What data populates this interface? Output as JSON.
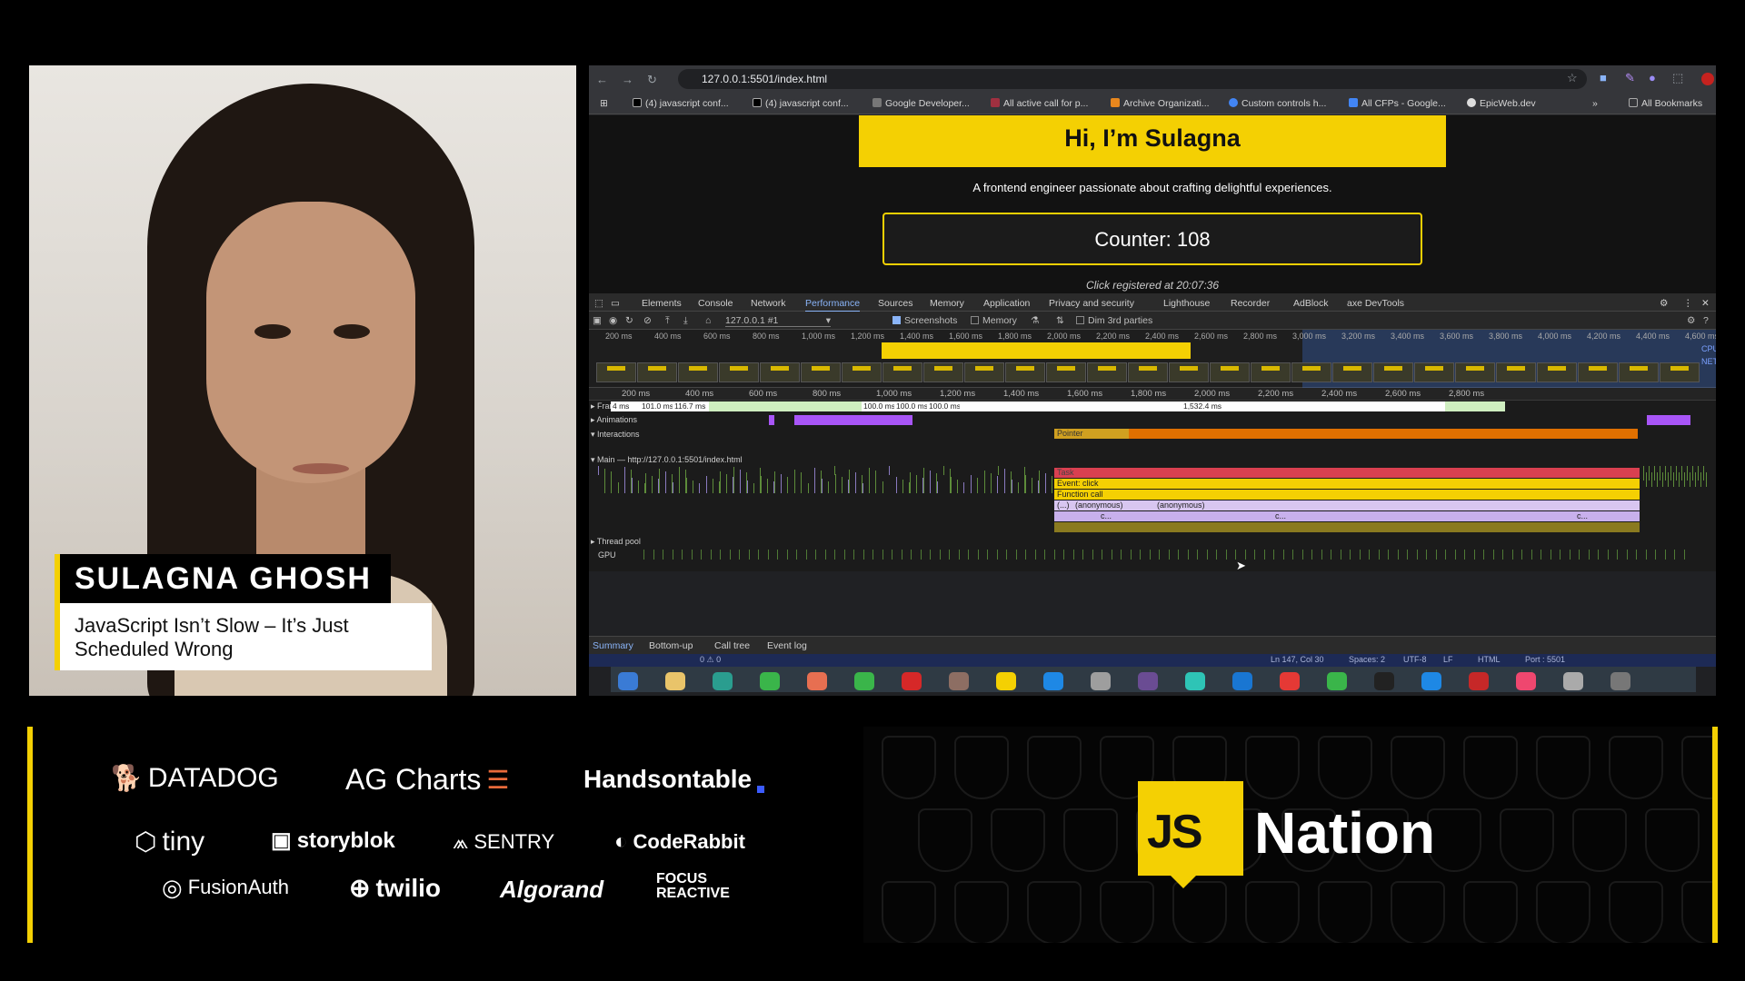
{
  "speaker": {
    "name": "SULAGNA GHOSH",
    "talk_title": "JavaScript Isn’t Slow – It’s Just Scheduled Wrong"
  },
  "browser": {
    "url": "127.0.0.1:5501/index.html",
    "bookmarks": [
      "(4) javascript conf...",
      "(4) javascript conf...",
      "Google Developer...",
      "All active call for p...",
      "Archive Organizati...",
      "Custom controls h...",
      "All CFPs - Google...",
      "EpicWeb.dev"
    ],
    "bookmarks_more": "»",
    "all_bookmarks": "All Bookmarks"
  },
  "page": {
    "heading": "Hi, I’m Sulagna",
    "tagline": "A frontend engineer passionate about crafting delightful experiences.",
    "counter": "Counter: 108",
    "click_status": "Click registered at 20:07:36"
  },
  "devtools": {
    "tabs": [
      "Elements",
      "Console",
      "Network",
      "Performance",
      "Sources",
      "Memory",
      "Application",
      "Privacy and security",
      "Lighthouse",
      "Recorder",
      "AdBlock",
      "axe DevTools"
    ],
    "active_tab": "Performance",
    "toolbar": {
      "recording": "127.0.0.1 #1",
      "screenshots": "Screenshots",
      "memory": "Memory",
      "dim_3rd": "Dim 3rd parties"
    },
    "overview_ticks": [
      "200 ms",
      "400 ms",
      "600 ms",
      "800 ms",
      "1,000 ms",
      "1,200 ms",
      "1,400 ms",
      "1,600 ms",
      "1,800 ms",
      "2,000 ms",
      "2,200 ms",
      "2,400 ms",
      "2,600 ms",
      "2,800 ms",
      "3,000 ms",
      "3,200 ms",
      "3,400 ms",
      "3,600 ms",
      "3,800 ms",
      "4,000 ms",
      "4,200 ms",
      "4,400 ms",
      "4,600 ms"
    ],
    "ruler_ticks": [
      "200 ms",
      "400 ms",
      "600 ms",
      "800 ms",
      "1,000 ms",
      "1,200 ms",
      "1,400 ms",
      "1,600 ms",
      "1,800 ms",
      "2,000 ms",
      "2,200 ms",
      "2,400 ms",
      "2,600 ms",
      "2,800 ms"
    ],
    "tracks": {
      "frames": "Frames",
      "frame_times": [
        "4 ms",
        "101.0 ms",
        "116.7 ms",
        "100.0 ms",
        "100.0 ms",
        "100.0 ms",
        "1,532.4 ms"
      ],
      "animations": "Animations",
      "interactions": "Interactions",
      "pointer": "Pointer",
      "main": "Main — http://127.0.0.1:5501/index.html",
      "task": "Task",
      "event_click": "Event: click",
      "function_call": "Function call",
      "anon1": "(...)",
      "anon2": "(anonymous)",
      "anon3": "(anonymous)",
      "c1": "c...",
      "c2": "c...",
      "c3": "c...",
      "thread_pool": "Thread pool",
      "gpu": "GPU"
    },
    "bottom_tabs": [
      "Summary",
      "Bottom-up",
      "Call tree",
      "Event log"
    ],
    "status": {
      "issues": "0 ⚠ 0",
      "position": "Ln 147, Col 30",
      "spaces": "Spaces: 2",
      "encoding": "UTF-8",
      "eol": "LF",
      "language": "HTML",
      "port": "Port : 5501"
    }
  },
  "sponsors": [
    "DATADOG",
    "AG Charts",
    "Handsontable",
    "tiny",
    "storyblok",
    "SENTRY",
    "CodeRabbit",
    "FusionAuth",
    "twilio",
    "Algorand",
    "FOCUS REACTIVE"
  ],
  "brand": {
    "logo": "JS",
    "name": "Nation"
  },
  "colors": {
    "accent": "#f4d003",
    "devtools_bg": "#202124",
    "link": "#8ab4f8"
  }
}
